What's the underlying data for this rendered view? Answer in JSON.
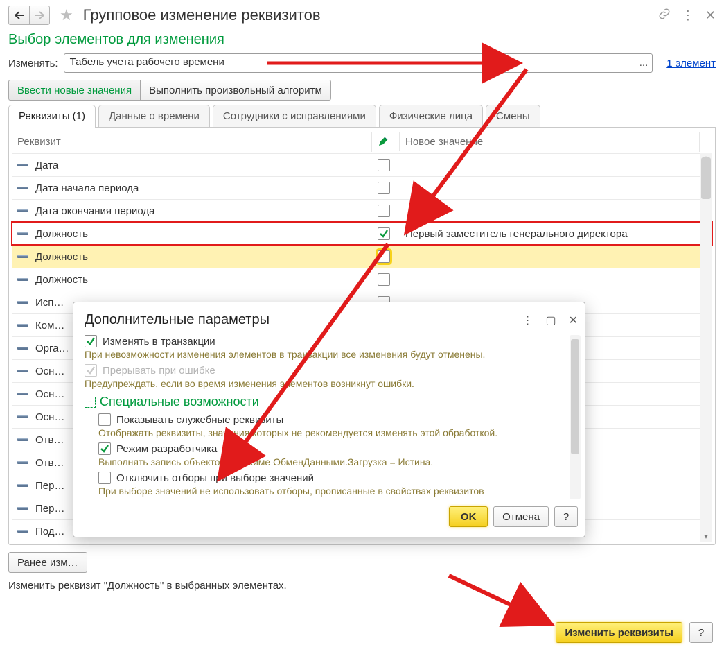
{
  "header": {
    "title": "Групповое изменение реквизитов"
  },
  "section_title": "Выбор элементов для изменения",
  "change_label": "Изменять:",
  "change_value": "Табель учета рабочего времени",
  "elements_link": "1 элемент",
  "mode_buttons": {
    "enter_values": "Ввести новые значения",
    "run_algo": "Выполнить произвольный алгоритм"
  },
  "tabs": [
    {
      "label": "Реквизиты (1)",
      "active": true
    },
    {
      "label": "Данные о времени",
      "active": false
    },
    {
      "label": "Сотрудники с исправлениями",
      "active": false
    },
    {
      "label": "Физические лица",
      "active": false
    },
    {
      "label": "Смены",
      "active": false
    }
  ],
  "grid_headers": {
    "attribute": "Реквизит",
    "new_value": "Новое значение"
  },
  "grid_rows": [
    {
      "label": "Дата",
      "checked": false,
      "value": "",
      "hl": ""
    },
    {
      "label": "Дата начала периода",
      "checked": false,
      "value": "",
      "hl": ""
    },
    {
      "label": "Дата окончания периода",
      "checked": false,
      "value": "",
      "hl": ""
    },
    {
      "label": "Должность",
      "checked": true,
      "value": "Первый заместитель генерального директора",
      "hl": "red"
    },
    {
      "label": "Должность",
      "checked": false,
      "value": "",
      "hl": "yellow"
    },
    {
      "label": "Должность",
      "checked": false,
      "value": "",
      "hl": ""
    },
    {
      "label": "Исп…",
      "checked": false,
      "value": "",
      "hl": ""
    },
    {
      "label": "Ком…",
      "checked": false,
      "value": "",
      "hl": ""
    },
    {
      "label": "Орга…",
      "checked": false,
      "value": "",
      "hl": ""
    },
    {
      "label": "Осн…",
      "checked": false,
      "value": "",
      "hl": ""
    },
    {
      "label": "Осн…",
      "checked": false,
      "value": "",
      "hl": ""
    },
    {
      "label": "Осн…",
      "checked": false,
      "value": "",
      "hl": ""
    },
    {
      "label": "Отв…",
      "checked": false,
      "value": "",
      "hl": ""
    },
    {
      "label": "Отв…",
      "checked": false,
      "value": "",
      "hl": ""
    },
    {
      "label": "Пер…",
      "checked": false,
      "value": "",
      "hl": ""
    },
    {
      "label": "Пер…",
      "checked": false,
      "value": "",
      "hl": ""
    },
    {
      "label": "Под…",
      "checked": false,
      "value": "",
      "hl": ""
    }
  ],
  "history_button": "Ранее изм…",
  "status_text": "Изменить реквизит \"Должность\" в выбранных элементах.",
  "main_action": "Изменить реквизиты",
  "help_q": "?",
  "dialog": {
    "title": "Дополнительные параметры",
    "opts": {
      "transaction_label": "Изменять в транзакции",
      "transaction_hint": "При невозможности изменения элементов в транзакции все изменения будут отменены.",
      "break_label": "Прерывать при ошибке",
      "break_hint": "Предупреждать, если во время изменения элементов возникнут ошибки.",
      "special_header": "Специальные возможности",
      "show_service_label": "Показывать служебные реквизиты",
      "show_service_hint": "Отображать реквизиты, значения которых не рекомендуется изменять этой обработкой.",
      "dev_mode_label": "Режим разработчика",
      "dev_mode_hint": "Выполнять запись объектов в режиме ОбменДанными.Загрузка = Истина.",
      "disable_filter_label": "Отключить отборы при выборе значений",
      "disable_filter_hint": "При выборе значений не использовать отборы, прописанные в свойствах реквизитов"
    },
    "ok": "OK",
    "cancel": "Отмена",
    "help": "?"
  }
}
